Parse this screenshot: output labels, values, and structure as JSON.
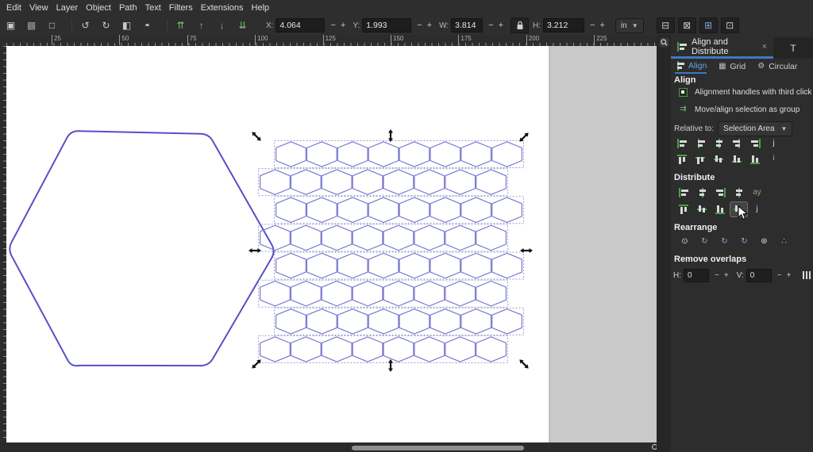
{
  "menu": {
    "items": [
      "Edit",
      "View",
      "Layer",
      "Object",
      "Path",
      "Text",
      "Filters",
      "Extensions",
      "Help"
    ]
  },
  "toolbar": {
    "select_icons": [
      {
        "name": "select-all-icon",
        "ch": "▣",
        "c": "#c9c9c9"
      },
      {
        "name": "select-all-layers-icon",
        "ch": "▩",
        "c": "#9a9a9a"
      },
      {
        "name": "deselect-icon",
        "ch": "□",
        "c": "#c9c9c9"
      }
    ],
    "transform_icons": [
      {
        "name": "rotate-ccw-icon",
        "ch": "↺",
        "c": "#c9c9c9"
      },
      {
        "name": "rotate-cw-icon",
        "ch": "↻",
        "c": "#c9c9c9"
      },
      {
        "name": "flip-horizontal-icon",
        "ch": "◧",
        "c": "#c9c9c9"
      },
      {
        "name": "flip-vertical-icon",
        "ch": "◓",
        "c": "#c9c9c9"
      }
    ],
    "zorder_icons": [
      {
        "name": "raise-to-top-icon",
        "ch": "⇈",
        "c": "#76c276"
      },
      {
        "name": "raise-icon",
        "ch": "↑",
        "c": "#76c276"
      },
      {
        "name": "lower-icon",
        "ch": "↓",
        "c": "#76c276"
      },
      {
        "name": "lower-to-bottom-icon",
        "ch": "⇊",
        "c": "#76c276"
      }
    ],
    "fields": {
      "x": {
        "label": "X:",
        "value": "4.064"
      },
      "y": {
        "label": "Y:",
        "value": "1.993"
      },
      "w": {
        "label": "W:",
        "value": "3.814"
      },
      "h": {
        "label": "H:",
        "value": "3.212"
      }
    },
    "minus": "−",
    "plus": "+",
    "unit": {
      "value": "in"
    },
    "affect_icons": [
      {
        "name": "scale-stroke-toggle-icon",
        "ch": "⊟",
        "c": "#c9c9c9"
      },
      {
        "name": "scale-corners-toggle-icon",
        "ch": "⊠",
        "c": "#c9c9c9"
      },
      {
        "name": "move-gradients-toggle-icon",
        "ch": "⊞",
        "c": "#7fa8d6"
      },
      {
        "name": "move-patterns-toggle-icon",
        "ch": "⊡",
        "c": "#c9c9c9"
      }
    ]
  },
  "ruler": {
    "h_labels": [
      "25",
      "50",
      "75",
      "100",
      "125",
      "150",
      "175",
      "200",
      "225"
    ]
  },
  "panel": {
    "dock_tab_title": "Align and Distribute",
    "dock_tab_close": "×",
    "dock_tab_secondary": "T",
    "subtabs": [
      {
        "label": "Align"
      },
      {
        "label": "Grid"
      },
      {
        "label": "Circular"
      }
    ],
    "align": {
      "title": "Align",
      "option1": "Alignment handles with third click",
      "option2": "Move/align selection as group",
      "relative_label": "Relative to:",
      "relative_value": "Selection Area"
    },
    "align_buttons_row1": [
      {
        "name": "align-left-edges-to-right-anchor-button",
        "o": "h",
        "p": 0
      },
      {
        "name": "align-left-edges-button",
        "o": "h",
        "p": 0.25
      },
      {
        "name": "center-on-vertical-axis-button",
        "o": "h",
        "p": 0.5
      },
      {
        "name": "align-right-edges-button",
        "o": "h",
        "p": 0.75
      },
      {
        "name": "align-right-edges-to-left-anchor-button",
        "o": "h",
        "p": 1
      },
      {
        "name": "align-text-anchors-horizontal-button",
        "ch": "j",
        "c": "#d8d8d8"
      }
    ],
    "align_buttons_row2": [
      {
        "name": "align-top-edges-to-bottom-anchor-button",
        "o": "v",
        "p": 0
      },
      {
        "name": "align-top-edges-button",
        "o": "v",
        "p": 0.25
      },
      {
        "name": "center-on-horizontal-axis-button",
        "o": "v",
        "p": 0.5
      },
      {
        "name": "align-bottom-edges-button",
        "o": "v",
        "p": 0.75
      },
      {
        "name": "align-bottom-edges-to-top-anchor-button",
        "o": "v",
        "p": 1
      },
      {
        "name": "align-text-anchors-vertical-button",
        "ch": "ʲ",
        "c": "#d8d8d8"
      }
    ],
    "distribute": {
      "title": "Distribute"
    },
    "distribute_buttons_row1": [
      {
        "name": "distribute-left-edges-button",
        "o": "h",
        "p": 0
      },
      {
        "name": "distribute-centers-horizontally-button",
        "o": "h",
        "p": 0.5
      },
      {
        "name": "distribute-right-edges-button",
        "o": "h",
        "p": 1
      },
      {
        "name": "distribute-horizontal-gaps-button",
        "o": "h",
        "p": 0.5
      },
      {
        "name": "distribute-text-anchors-horizontal-button",
        "ch": "ay",
        "c": "#8fa878"
      }
    ],
    "distribute_buttons_row2": [
      {
        "name": "distribute-top-edges-button",
        "o": "v",
        "p": 0
      },
      {
        "name": "distribute-centers-vertically-button",
        "o": "v",
        "p": 0.5
      },
      {
        "name": "distribute-bottom-edges-button",
        "o": "v",
        "p": 1
      },
      {
        "name": "distribute-vertical-gaps-button",
        "o": "v",
        "p": 0.5,
        "highlight": true
      },
      {
        "name": "distribute-text-baselines-button",
        "ch": "j",
        "c": "#d8d8d8"
      }
    ],
    "rearrange": {
      "title": "Rearrange"
    },
    "rearrange_buttons": [
      {
        "name": "graph-layout-button",
        "ch": "⊙",
        "c": "#d8d8d8"
      },
      {
        "name": "exchange-selection-order-button",
        "ch": "↻",
        "c": "#7fb2e5"
      },
      {
        "name": "exchange-stacking-order-button",
        "ch": "↻",
        "c": "#7fb2e5"
      },
      {
        "name": "exchange-clockwise-button",
        "ch": "↻",
        "c": "#7fb2e5"
      },
      {
        "name": "randomize-centers-button",
        "ch": "⊛",
        "c": "#d8d8d8"
      },
      {
        "name": "unclump-button",
        "ch": "∴",
        "c": "#d8d8d8"
      }
    ],
    "remove_overlaps": {
      "title": "Remove overlaps",
      "h_label": "H:",
      "h_value": "0",
      "v_label": "V:",
      "v_value": "0"
    },
    "remove_overlaps_button": {
      "name": "remove-overlaps-apply-button",
      "k": "bars3"
    }
  },
  "canvas": {
    "page_color": "#ffffff",
    "desk_color": "#c9c9c9",
    "big_hexagon": {
      "stroke": "#574fc6"
    },
    "hex_grid": {
      "rows": 8,
      "cols": 8,
      "hex_stroke": "#7b79d2",
      "marquee_stroke": "#98a1c8"
    },
    "selection_handle_color": "#111111"
  }
}
